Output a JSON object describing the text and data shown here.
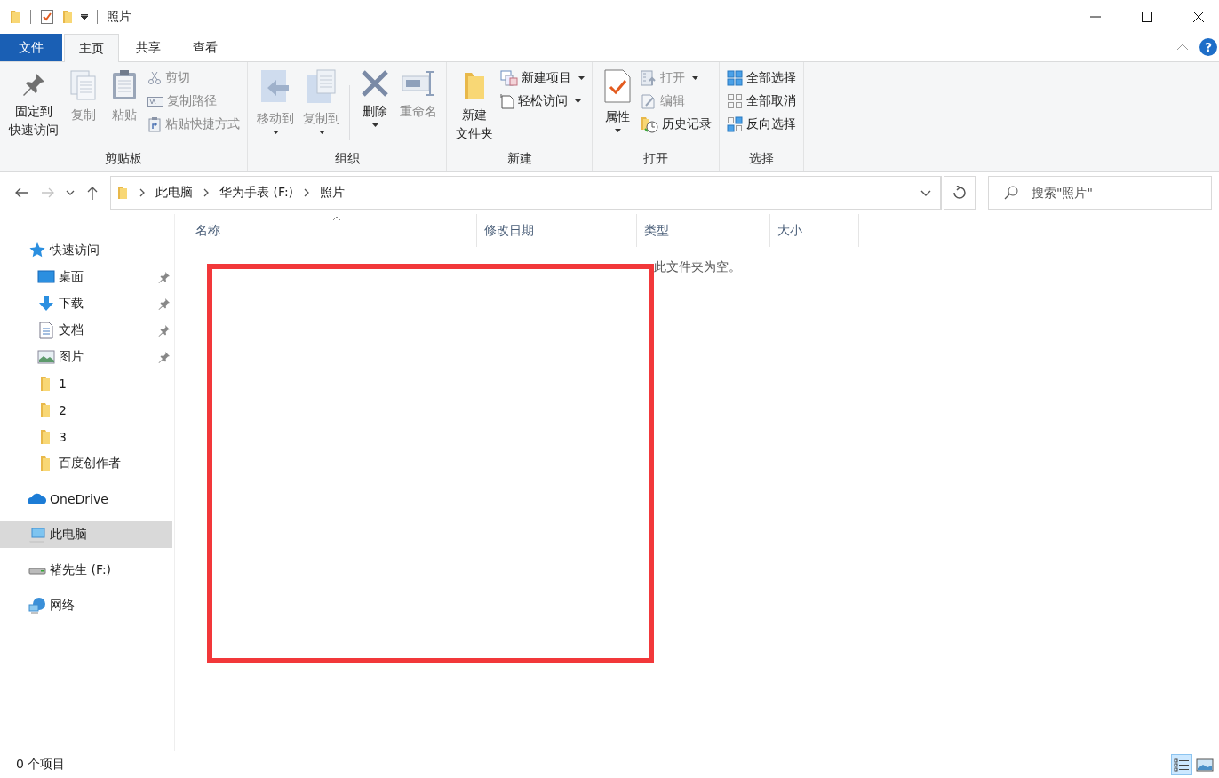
{
  "window": {
    "title": "照片"
  },
  "ribbon_tabs": [
    {
      "label": "文件",
      "kind": "file",
      "selected": false
    },
    {
      "label": "主页",
      "kind": "tab",
      "selected": true
    },
    {
      "label": "共享",
      "kind": "tab",
      "selected": false
    },
    {
      "label": "查看",
      "kind": "tab",
      "selected": false
    }
  ],
  "help_button": {
    "label": "?"
  },
  "ribbon_groups": [
    {
      "label": "剪贴板",
      "columns": [
        {
          "kind": "large",
          "label_lines": [
            "固定到",
            "快速访问"
          ],
          "disabled": false,
          "dropdown": false
        },
        {
          "kind": "large",
          "label": "复制",
          "disabled": true,
          "dropdown": false
        },
        {
          "kind": "large",
          "label": "粘贴",
          "disabled": true,
          "dropdown": false
        },
        {
          "kind": "stack",
          "items": [
            {
              "label": "剪切",
              "disabled": true,
              "dropdown": false
            },
            {
              "label": "复制路径",
              "disabled": true,
              "dropdown": false
            },
            {
              "label": "粘贴快捷方式",
              "disabled": true,
              "dropdown": false
            }
          ]
        }
      ]
    },
    {
      "label": "组织",
      "columns": [
        {
          "kind": "large",
          "label": "移动到",
          "disabled": true,
          "dropdown": true
        },
        {
          "kind": "large",
          "label": "复制到",
          "disabled": true,
          "dropdown": true
        },
        {
          "kind": "separator"
        },
        {
          "kind": "large",
          "label": "删除",
          "disabled": false,
          "dropdown": true
        },
        {
          "kind": "large",
          "label": "重命名",
          "disabled": true,
          "dropdown": false
        }
      ]
    },
    {
      "label": "新建",
      "columns": [
        {
          "kind": "large",
          "label_lines": [
            "新建",
            "文件夹"
          ],
          "disabled": false,
          "dropdown": false
        },
        {
          "kind": "stack",
          "items": [
            {
              "label": "新建项目",
              "disabled": false,
              "dropdown": true
            },
            {
              "label": "轻松访问",
              "disabled": false,
              "dropdown": true
            }
          ]
        }
      ]
    },
    {
      "label": "打开",
      "columns": [
        {
          "kind": "large",
          "label": "属性",
          "disabled": false,
          "dropdown": true
        },
        {
          "kind": "stack",
          "items": [
            {
              "label": "打开",
              "disabled": true,
              "dropdown": true
            },
            {
              "label": "编辑",
              "disabled": true,
              "dropdown": false
            },
            {
              "label": "历史记录",
              "disabled": false,
              "dropdown": false
            }
          ]
        }
      ]
    },
    {
      "label": "选择",
      "columns": [
        {
          "kind": "stack",
          "items": [
            {
              "label": "全部选择",
              "disabled": false,
              "dropdown": false
            },
            {
              "label": "全部取消",
              "disabled": false,
              "dropdown": false
            },
            {
              "label": "反向选择",
              "disabled": false,
              "dropdown": false
            }
          ]
        }
      ]
    }
  ],
  "address": {
    "back_disabled": false,
    "forward_disabled": true,
    "breadcrumbs": [
      "此电脑",
      "华为手表 (F:)",
      "照片"
    ]
  },
  "search": {
    "placeholder": "搜索\"照片\""
  },
  "sidebar": {
    "items": [
      {
        "label": "快速访问",
        "kind": "quick",
        "selected": false,
        "children": [
          {
            "label": "桌面",
            "kind": "desktop",
            "pinned": true,
            "selected": false
          },
          {
            "label": "下载",
            "kind": "download",
            "pinned": true,
            "selected": false
          },
          {
            "label": "文档",
            "kind": "document",
            "pinned": true,
            "selected": false
          },
          {
            "label": "图片",
            "kind": "picture",
            "pinned": true,
            "selected": false
          },
          {
            "label": "1",
            "kind": "folder",
            "pinned": false,
            "selected": false
          },
          {
            "label": "2",
            "kind": "folder",
            "pinned": false,
            "selected": false
          },
          {
            "label": "3",
            "kind": "folder",
            "pinned": false,
            "selected": false
          },
          {
            "label": "百度创作者",
            "kind": "folder",
            "pinned": false,
            "selected": false
          }
        ]
      },
      {
        "label": "OneDrive",
        "kind": "cloud",
        "selected": false
      },
      {
        "label": "此电脑",
        "kind": "computer",
        "selected": true
      },
      {
        "label": "褚先生 (F:)",
        "kind": "drive",
        "selected": false
      },
      {
        "label": "网络",
        "kind": "network",
        "selected": false
      }
    ]
  },
  "file_list": {
    "columns": [
      {
        "label": "名称",
        "sorted": true
      },
      {
        "label": "修改日期",
        "sorted": false
      },
      {
        "label": "类型",
        "sorted": false
      },
      {
        "label": "大小",
        "sorted": false
      }
    ],
    "empty_text": "此文件夹为空。"
  },
  "status_bar": {
    "count": "0 个项目",
    "views": [
      {
        "kind": "details",
        "selected": true
      },
      {
        "kind": "large_icons",
        "selected": false
      }
    ]
  }
}
